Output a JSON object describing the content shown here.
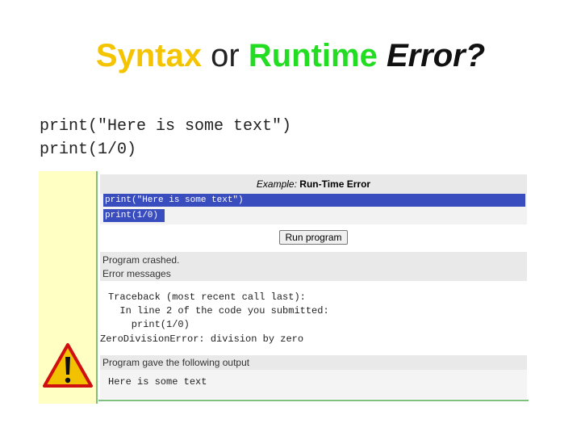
{
  "slide": {
    "title_syntax": "Syntax",
    "title_or": "or",
    "title_runtime": "Runtime",
    "title_error": "Error?",
    "code_lines": [
      "print(\"Here is some text\")",
      "print(1/0)"
    ]
  },
  "screenshot": {
    "header_italic": "Example:",
    "header_bold": "Run-Time Error",
    "code_lines": [
      "print(\"Here is some text\")",
      "print(1/0)"
    ],
    "run_button": "Run program",
    "status_crashed": "Program crashed.",
    "status_errors": "Error messages",
    "traceback": [
      "Traceback (most recent call last):",
      "  In line 2 of the code you submitted:",
      "    print(1/0)",
      "ZeroDivisionError: division by zero"
    ],
    "output_label": "Program gave the following output",
    "output_text": "Here is some text"
  },
  "colors": {
    "syntax": "#f5c400",
    "runtime": "#22dd22",
    "selection": "#3a4dbf",
    "warning": "#f2c200"
  },
  "icons": [
    "warning-icon"
  ]
}
